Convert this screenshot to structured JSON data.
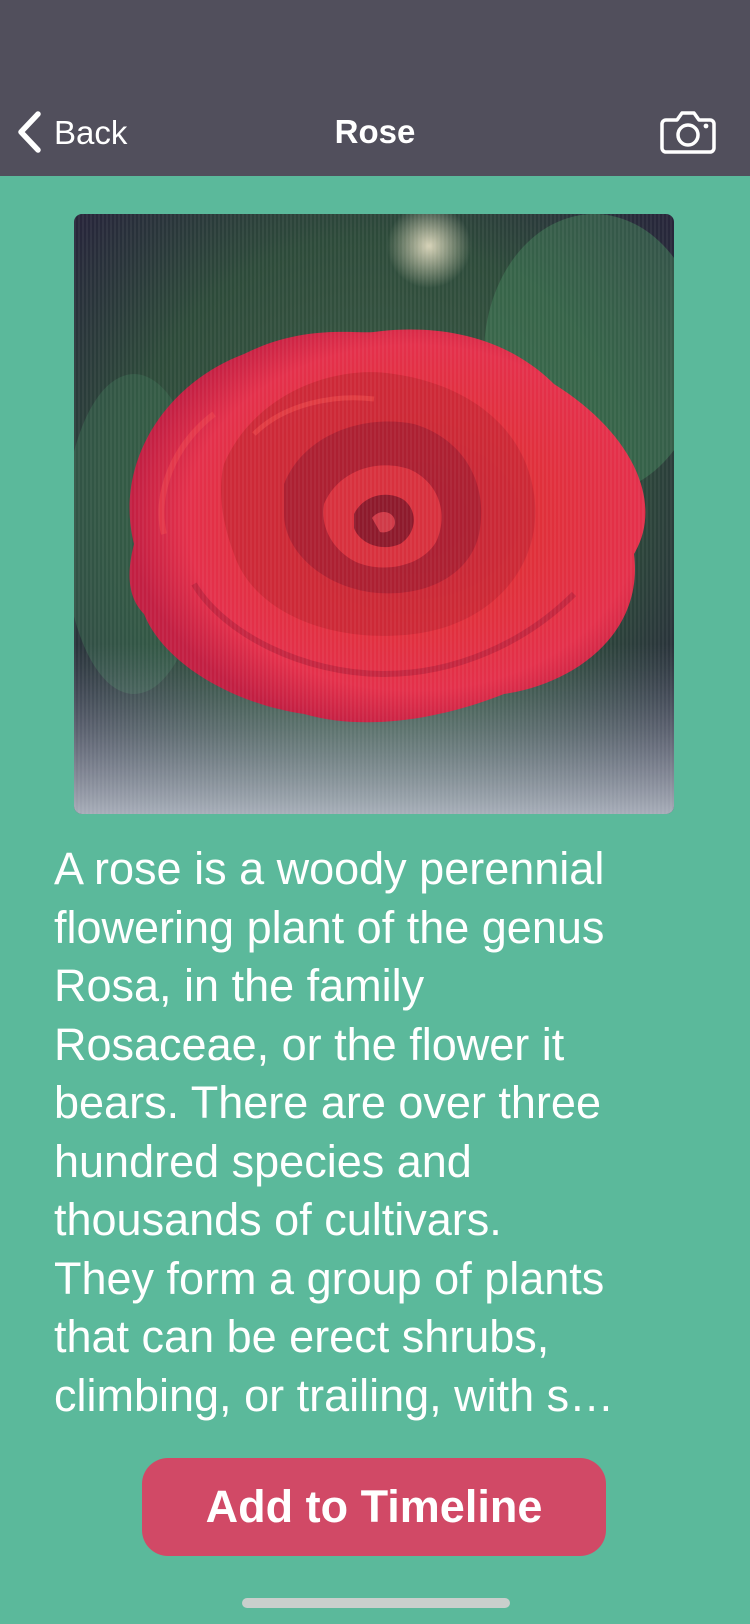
{
  "nav": {
    "back_label": "Back",
    "title": "Rose"
  },
  "icons": {
    "back": "chevron-left-icon",
    "camera": "camera-icon"
  },
  "photo": {
    "subject": "red rose"
  },
  "description": "A rose is a woody perennial\nflowering plant of the genus\nRosa, in the family\nRosaceae, or the flower it\nbears.  There are over three\nhundred species and\nthousands of cultivars.\nThey form a group of plants\nthat can be erect shrubs,\nclimbing, or trailing, with s…",
  "actions": {
    "add_label": "Add to Timeline"
  },
  "colors": {
    "background": "#5bb99b",
    "navbar": "#514f5c",
    "button": "#d14966",
    "text": "#ffffff"
  }
}
